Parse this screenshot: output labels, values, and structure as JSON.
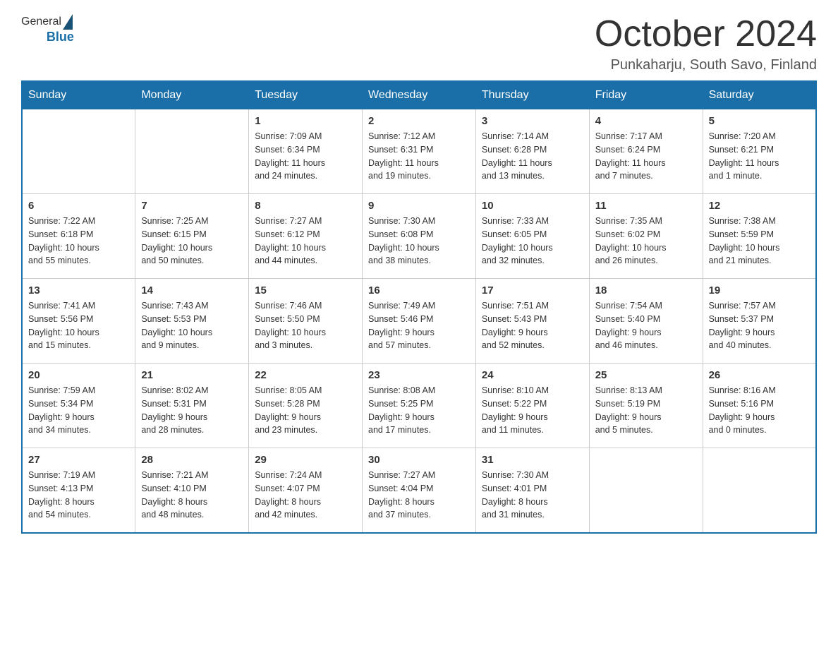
{
  "header": {
    "month": "October 2024",
    "location": "Punkaharju, South Savo, Finland",
    "logo_general": "General",
    "logo_blue": "Blue"
  },
  "days_of_week": [
    "Sunday",
    "Monday",
    "Tuesday",
    "Wednesday",
    "Thursday",
    "Friday",
    "Saturday"
  ],
  "weeks": [
    [
      {
        "day": "",
        "info": ""
      },
      {
        "day": "",
        "info": ""
      },
      {
        "day": "1",
        "info": "Sunrise: 7:09 AM\nSunset: 6:34 PM\nDaylight: 11 hours\nand 24 minutes."
      },
      {
        "day": "2",
        "info": "Sunrise: 7:12 AM\nSunset: 6:31 PM\nDaylight: 11 hours\nand 19 minutes."
      },
      {
        "day": "3",
        "info": "Sunrise: 7:14 AM\nSunset: 6:28 PM\nDaylight: 11 hours\nand 13 minutes."
      },
      {
        "day": "4",
        "info": "Sunrise: 7:17 AM\nSunset: 6:24 PM\nDaylight: 11 hours\nand 7 minutes."
      },
      {
        "day": "5",
        "info": "Sunrise: 7:20 AM\nSunset: 6:21 PM\nDaylight: 11 hours\nand 1 minute."
      }
    ],
    [
      {
        "day": "6",
        "info": "Sunrise: 7:22 AM\nSunset: 6:18 PM\nDaylight: 10 hours\nand 55 minutes."
      },
      {
        "day": "7",
        "info": "Sunrise: 7:25 AM\nSunset: 6:15 PM\nDaylight: 10 hours\nand 50 minutes."
      },
      {
        "day": "8",
        "info": "Sunrise: 7:27 AM\nSunset: 6:12 PM\nDaylight: 10 hours\nand 44 minutes."
      },
      {
        "day": "9",
        "info": "Sunrise: 7:30 AM\nSunset: 6:08 PM\nDaylight: 10 hours\nand 38 minutes."
      },
      {
        "day": "10",
        "info": "Sunrise: 7:33 AM\nSunset: 6:05 PM\nDaylight: 10 hours\nand 32 minutes."
      },
      {
        "day": "11",
        "info": "Sunrise: 7:35 AM\nSunset: 6:02 PM\nDaylight: 10 hours\nand 26 minutes."
      },
      {
        "day": "12",
        "info": "Sunrise: 7:38 AM\nSunset: 5:59 PM\nDaylight: 10 hours\nand 21 minutes."
      }
    ],
    [
      {
        "day": "13",
        "info": "Sunrise: 7:41 AM\nSunset: 5:56 PM\nDaylight: 10 hours\nand 15 minutes."
      },
      {
        "day": "14",
        "info": "Sunrise: 7:43 AM\nSunset: 5:53 PM\nDaylight: 10 hours\nand 9 minutes."
      },
      {
        "day": "15",
        "info": "Sunrise: 7:46 AM\nSunset: 5:50 PM\nDaylight: 10 hours\nand 3 minutes."
      },
      {
        "day": "16",
        "info": "Sunrise: 7:49 AM\nSunset: 5:46 PM\nDaylight: 9 hours\nand 57 minutes."
      },
      {
        "day": "17",
        "info": "Sunrise: 7:51 AM\nSunset: 5:43 PM\nDaylight: 9 hours\nand 52 minutes."
      },
      {
        "day": "18",
        "info": "Sunrise: 7:54 AM\nSunset: 5:40 PM\nDaylight: 9 hours\nand 46 minutes."
      },
      {
        "day": "19",
        "info": "Sunrise: 7:57 AM\nSunset: 5:37 PM\nDaylight: 9 hours\nand 40 minutes."
      }
    ],
    [
      {
        "day": "20",
        "info": "Sunrise: 7:59 AM\nSunset: 5:34 PM\nDaylight: 9 hours\nand 34 minutes."
      },
      {
        "day": "21",
        "info": "Sunrise: 8:02 AM\nSunset: 5:31 PM\nDaylight: 9 hours\nand 28 minutes."
      },
      {
        "day": "22",
        "info": "Sunrise: 8:05 AM\nSunset: 5:28 PM\nDaylight: 9 hours\nand 23 minutes."
      },
      {
        "day": "23",
        "info": "Sunrise: 8:08 AM\nSunset: 5:25 PM\nDaylight: 9 hours\nand 17 minutes."
      },
      {
        "day": "24",
        "info": "Sunrise: 8:10 AM\nSunset: 5:22 PM\nDaylight: 9 hours\nand 11 minutes."
      },
      {
        "day": "25",
        "info": "Sunrise: 8:13 AM\nSunset: 5:19 PM\nDaylight: 9 hours\nand 5 minutes."
      },
      {
        "day": "26",
        "info": "Sunrise: 8:16 AM\nSunset: 5:16 PM\nDaylight: 9 hours\nand 0 minutes."
      }
    ],
    [
      {
        "day": "27",
        "info": "Sunrise: 7:19 AM\nSunset: 4:13 PM\nDaylight: 8 hours\nand 54 minutes."
      },
      {
        "day": "28",
        "info": "Sunrise: 7:21 AM\nSunset: 4:10 PM\nDaylight: 8 hours\nand 48 minutes."
      },
      {
        "day": "29",
        "info": "Sunrise: 7:24 AM\nSunset: 4:07 PM\nDaylight: 8 hours\nand 42 minutes."
      },
      {
        "day": "30",
        "info": "Sunrise: 7:27 AM\nSunset: 4:04 PM\nDaylight: 8 hours\nand 37 minutes."
      },
      {
        "day": "31",
        "info": "Sunrise: 7:30 AM\nSunset: 4:01 PM\nDaylight: 8 hours\nand 31 minutes."
      },
      {
        "day": "",
        "info": ""
      },
      {
        "day": "",
        "info": ""
      }
    ]
  ]
}
